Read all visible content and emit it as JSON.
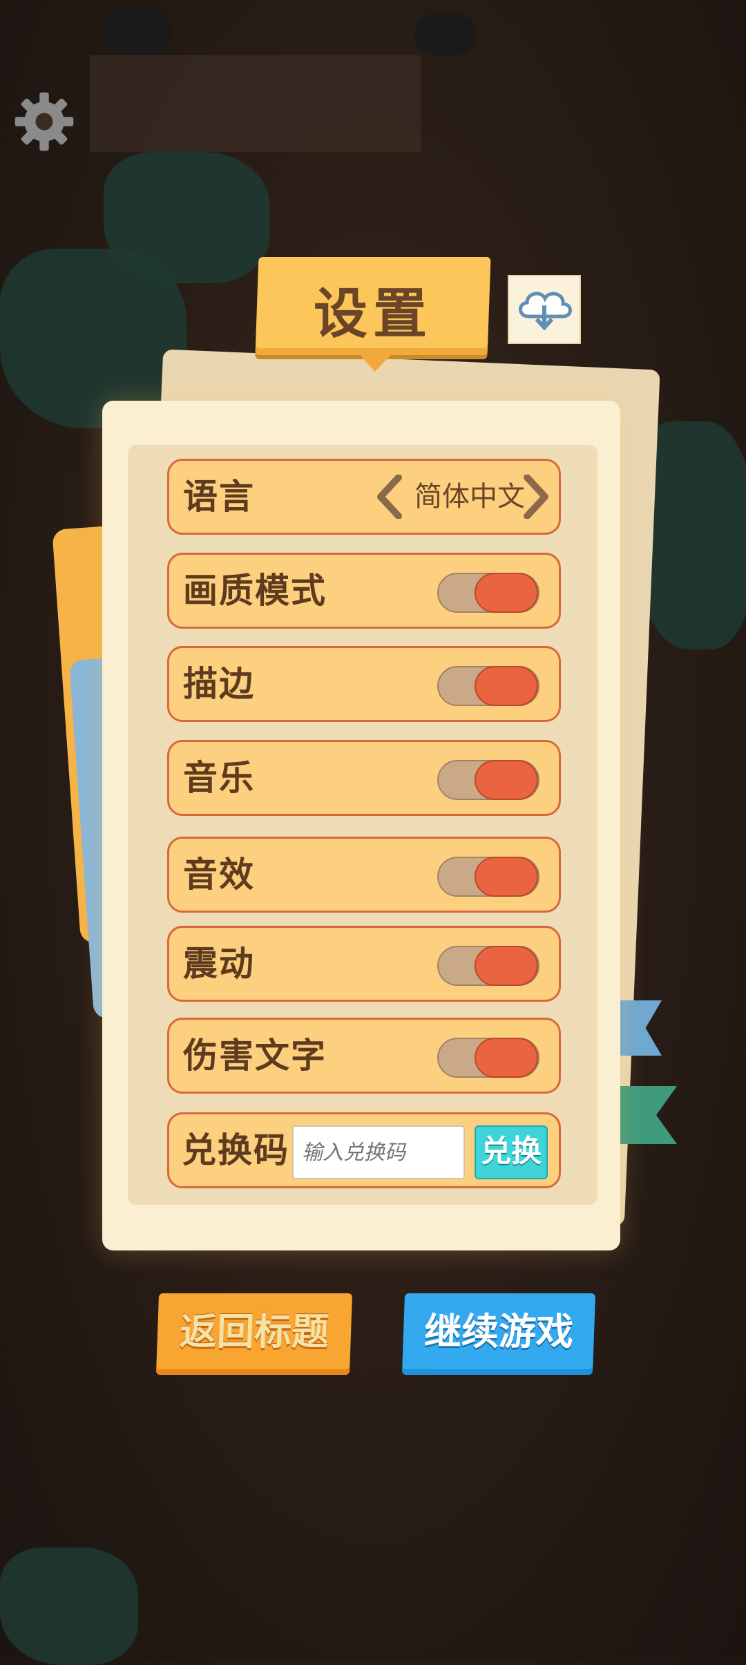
{
  "header": {
    "title": "设置",
    "settings_icon": "gear-icon",
    "cloud_icon": "cloud-download-icon"
  },
  "settings": {
    "language": {
      "label": "语言",
      "value": "简体中文"
    },
    "toggles": [
      {
        "label": "画质模式",
        "on": true
      },
      {
        "label": "描边",
        "on": true
      },
      {
        "label": "音乐",
        "on": true
      },
      {
        "label": "音效",
        "on": true
      },
      {
        "label": "震动",
        "on": true
      },
      {
        "label": "伤害文字",
        "on": true
      }
    ],
    "redeem": {
      "label": "兑换码",
      "placeholder": "输入兑换码",
      "button": "兑换"
    }
  },
  "footer": {
    "back_label": "返回标题",
    "continue_label": "继续游戏"
  },
  "colors": {
    "row_fill": "#fdd07f",
    "row_border": "#d8683b",
    "toggle_on": "#ea6442",
    "back_button": "#f8a531",
    "continue_button": "#33a9f0",
    "redeem_button": "#3fd3da"
  }
}
